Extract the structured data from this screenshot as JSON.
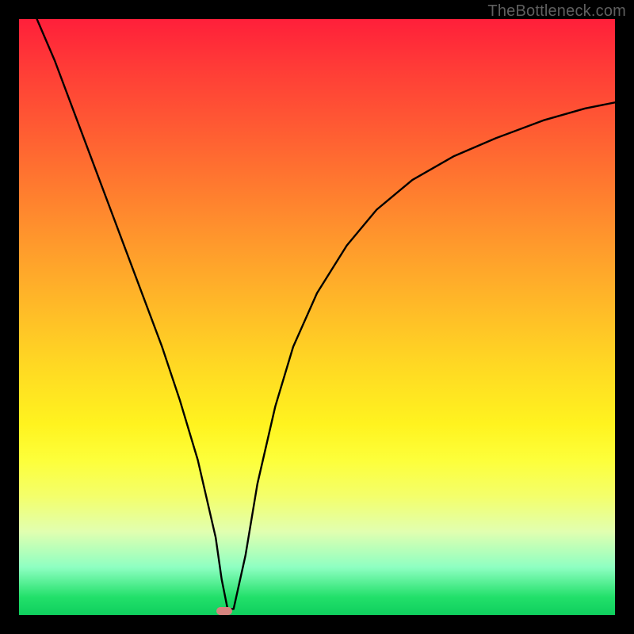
{
  "watermark": "TheBottleneck.com",
  "chart_data": {
    "type": "line",
    "title": "",
    "xlabel": "",
    "ylabel": "",
    "xlim": [
      0,
      100
    ],
    "ylim": [
      0,
      100
    ],
    "grid": false,
    "series": [
      {
        "name": "curve",
        "x": [
          3,
          6,
          9,
          12,
          15,
          18,
          21,
          24,
          27,
          30,
          33,
          34,
          35,
          36,
          38,
          40,
          43,
          46,
          50,
          55,
          60,
          66,
          73,
          80,
          88,
          95,
          100
        ],
        "y": [
          100,
          93,
          85,
          77,
          69,
          61,
          53,
          45,
          36,
          26,
          13,
          6,
          1,
          1,
          10,
          22,
          35,
          45,
          54,
          62,
          68,
          73,
          77,
          80,
          83,
          85,
          86
        ]
      }
    ],
    "marker": {
      "x": 34.5,
      "y": 0.7
    },
    "background_gradient": {
      "top": "#ff1f3a",
      "mid": "#ffe030",
      "bottom": "#0fcf5e"
    }
  }
}
